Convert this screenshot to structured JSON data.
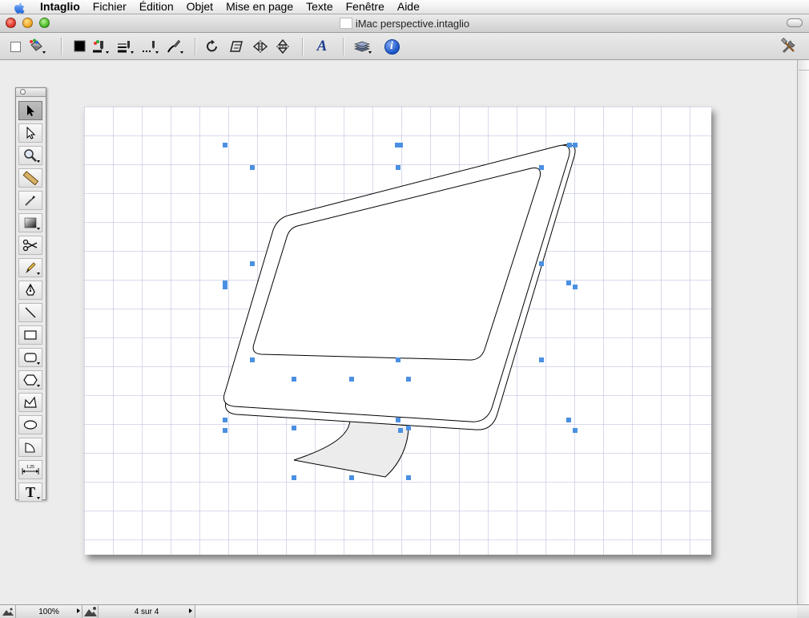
{
  "menubar": {
    "app_name": "Intaglio",
    "items": [
      "Fichier",
      "Édition",
      "Objet",
      "Mise en page",
      "Texte",
      "Fenêtre",
      "Aide"
    ]
  },
  "window": {
    "title": "iMac perspective.intaglio"
  },
  "statusbar": {
    "zoom": "100%",
    "page_indicator": "4 sur 4"
  },
  "colors": {
    "selection_handle": "#4a90e2",
    "grid_line": "#b3b6d8",
    "accent_blue": "#1a55c8"
  },
  "tool_palette": {
    "tools": [
      "selection-arrow-icon",
      "direct-select-icon",
      "zoom-icon",
      "ruler-icon",
      "eyedropper-icon",
      "gradient-icon",
      "scissors-icon",
      "pencil-icon",
      "pen-icon",
      "line-icon",
      "rectangle-icon",
      "rounded-rectangle-icon",
      "polygon-icon",
      "freehand-shape-icon",
      "ellipse-icon",
      "arc-icon",
      "dimension-icon",
      "text-icon"
    ],
    "dimension_label": "1.25",
    "text_tool_glyph": "T"
  },
  "toolbar": {
    "text_style_glyph": "A",
    "info_glyph": "i"
  }
}
